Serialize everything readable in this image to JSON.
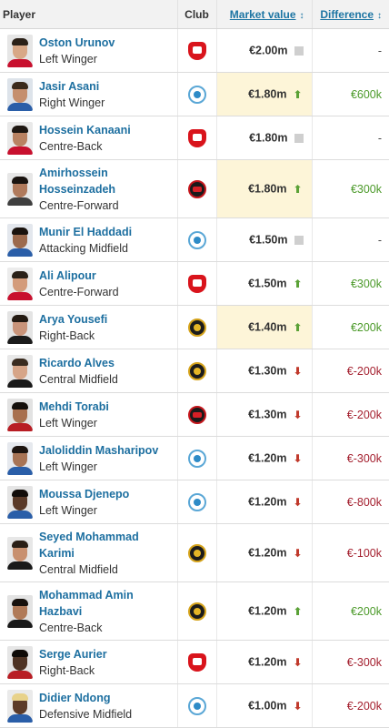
{
  "header": {
    "player": "Player",
    "club": "Club",
    "market_value": "Market value",
    "difference": "Difference",
    "sort_glyph": "↕"
  },
  "colors": {
    "link_blue": "#1d6fa0",
    "up_green": "#5aa136",
    "down_red": "#c0392b",
    "highlight": "#fdf5d8"
  },
  "rows": [
    {
      "name": "Oston Urunov",
      "position": "Left Winger",
      "club_icon": "persepolis-crest-icon",
      "value": "€2.00m",
      "trend": "same",
      "difference": "-",
      "highlight": false
    },
    {
      "name": "Jasir Asani",
      "position": "Right Winger",
      "club_icon": "esteghlal-crest-icon",
      "value": "€1.80m",
      "trend": "up",
      "difference": "€600k",
      "highlight": true
    },
    {
      "name": "Hossein Kanaani",
      "position": "Centre-Back",
      "club_icon": "persepolis-crest-icon",
      "value": "€1.80m",
      "trend": "same",
      "difference": "-",
      "highlight": false
    },
    {
      "name": "Amirhossein\nHosseinzadeh",
      "position": "Centre-Forward",
      "club_icon": "tractor-crest-icon",
      "value": "€1.80m",
      "trend": "up",
      "difference": "€300k",
      "highlight": true
    },
    {
      "name": "Munir El Haddadi",
      "position": "Attacking Midfield",
      "club_icon": "esteghlal-crest-icon",
      "value": "€1.50m",
      "trend": "same",
      "difference": "-",
      "highlight": false
    },
    {
      "name": "Ali Alipour",
      "position": "Centre-Forward",
      "club_icon": "persepolis-crest-icon",
      "value": "€1.50m",
      "trend": "up",
      "difference": "€300k",
      "highlight": false
    },
    {
      "name": "Arya Yousefi",
      "position": "Right-Back",
      "club_icon": "sepahan-crest-icon",
      "value": "€1.40m",
      "trend": "up",
      "difference": "€200k",
      "highlight": true
    },
    {
      "name": "Ricardo Alves",
      "position": "Central Midfield",
      "club_icon": "sepahan-crest-icon",
      "value": "€1.30m",
      "trend": "down",
      "difference": "€-200k",
      "highlight": false
    },
    {
      "name": "Mehdi Torabi",
      "position": "Left Winger",
      "club_icon": "tractor-crest-icon",
      "value": "€1.30m",
      "trend": "down",
      "difference": "€-200k",
      "highlight": false
    },
    {
      "name": "Jaloliddin Masharipov",
      "position": "Left Winger",
      "club_icon": "esteghlal-crest-icon",
      "value": "€1.20m",
      "trend": "down",
      "difference": "€-300k",
      "highlight": false
    },
    {
      "name": "Moussa Djenepo",
      "position": "Left Winger",
      "club_icon": "esteghlal-crest-icon",
      "value": "€1.20m",
      "trend": "down",
      "difference": "€-800k",
      "highlight": false
    },
    {
      "name": "Seyed Mohammad\nKarimi",
      "position": "Central Midfield",
      "club_icon": "sepahan-crest-icon",
      "value": "€1.20m",
      "trend": "down",
      "difference": "€-100k",
      "highlight": false
    },
    {
      "name": "Mohammad Amin\nHazbavi",
      "position": "Centre-Back",
      "club_icon": "sepahan-crest-icon",
      "value": "€1.20m",
      "trend": "up",
      "difference": "€200k",
      "highlight": false
    },
    {
      "name": "Serge Aurier",
      "position": "Right-Back",
      "club_icon": "persepolis-crest-icon",
      "value": "€1.20m",
      "trend": "down",
      "difference": "€-300k",
      "highlight": false
    },
    {
      "name": "Didier Ndong",
      "position": "Defensive Midfield",
      "club_icon": "esteghlal-crest-icon",
      "value": "€1.00m",
      "trend": "down",
      "difference": "€-200k",
      "highlight": false
    }
  ]
}
